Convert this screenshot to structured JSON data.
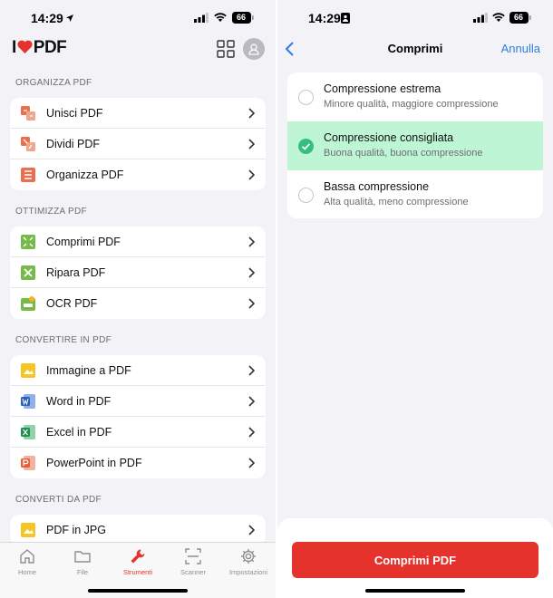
{
  "left": {
    "status": {
      "time": "14:29",
      "battery": "66"
    },
    "logo": {
      "text_i": "I",
      "text_pdf": "PDF"
    },
    "sections": [
      {
        "title": "ORGANIZZA PDF",
        "items": [
          {
            "label": "Unisci PDF",
            "icon": "merge-icon",
            "color": "#e96f4f"
          },
          {
            "label": "Dividi PDF",
            "icon": "split-icon",
            "color": "#e96f4f"
          },
          {
            "label": "Organizza PDF",
            "icon": "organize-icon",
            "color": "#e96f4f"
          }
        ]
      },
      {
        "title": "OTTIMIZZA PDF",
        "items": [
          {
            "label": "Comprimi PDF",
            "icon": "compress-icon",
            "color": "#76bb4a"
          },
          {
            "label": "Ripara PDF",
            "icon": "repair-icon",
            "color": "#76bb4a"
          },
          {
            "label": "OCR PDF",
            "icon": "ocr-icon",
            "color": "#76bb4a"
          }
        ]
      },
      {
        "title": "CONVERTIRE IN PDF",
        "items": [
          {
            "label": "Immagine a PDF",
            "icon": "image-to-pdf-icon",
            "color": "#f3c623"
          },
          {
            "label": "Word in PDF",
            "icon": "word-to-pdf-icon",
            "color": "#2b5eb8"
          },
          {
            "label": "Excel in PDF",
            "icon": "excel-to-pdf-icon",
            "color": "#1f8f4d"
          },
          {
            "label": "PowerPoint in PDF",
            "icon": "powerpoint-to-pdf-icon",
            "color": "#e2603b"
          }
        ]
      },
      {
        "title": "CONVERTI DA PDF",
        "items": [
          {
            "label": "PDF in JPG",
            "icon": "pdf-to-jpg-icon",
            "color": "#f3c623"
          }
        ]
      }
    ],
    "tabs": [
      {
        "label": "Home",
        "icon": "home-icon"
      },
      {
        "label": "File",
        "icon": "folder-icon"
      },
      {
        "label": "Strumenti",
        "icon": "wrench-icon",
        "active": true
      },
      {
        "label": "Scanner",
        "icon": "scanner-icon"
      },
      {
        "label": "Impostazioni",
        "icon": "gear-icon"
      }
    ]
  },
  "right": {
    "status": {
      "time": "14:29",
      "battery": "66"
    },
    "nav": {
      "title": "Comprimi",
      "cancel": "Annulla"
    },
    "options": [
      {
        "title": "Compressione estrema",
        "subtitle": "Minore qualità, maggiore compressione",
        "selected": false
      },
      {
        "title": "Compressione consigliata",
        "subtitle": "Buona qualità, buona compressione",
        "selected": true
      },
      {
        "title": "Bassa compressione",
        "subtitle": "Alta qualità, meno compressione",
        "selected": false
      }
    ],
    "cta": "Comprimi PDF"
  },
  "colors": {
    "accent": "#e5322d",
    "selected_bg": "#bdf5d5",
    "selected_check": "#34c07a",
    "link": "#2f7ddf"
  }
}
